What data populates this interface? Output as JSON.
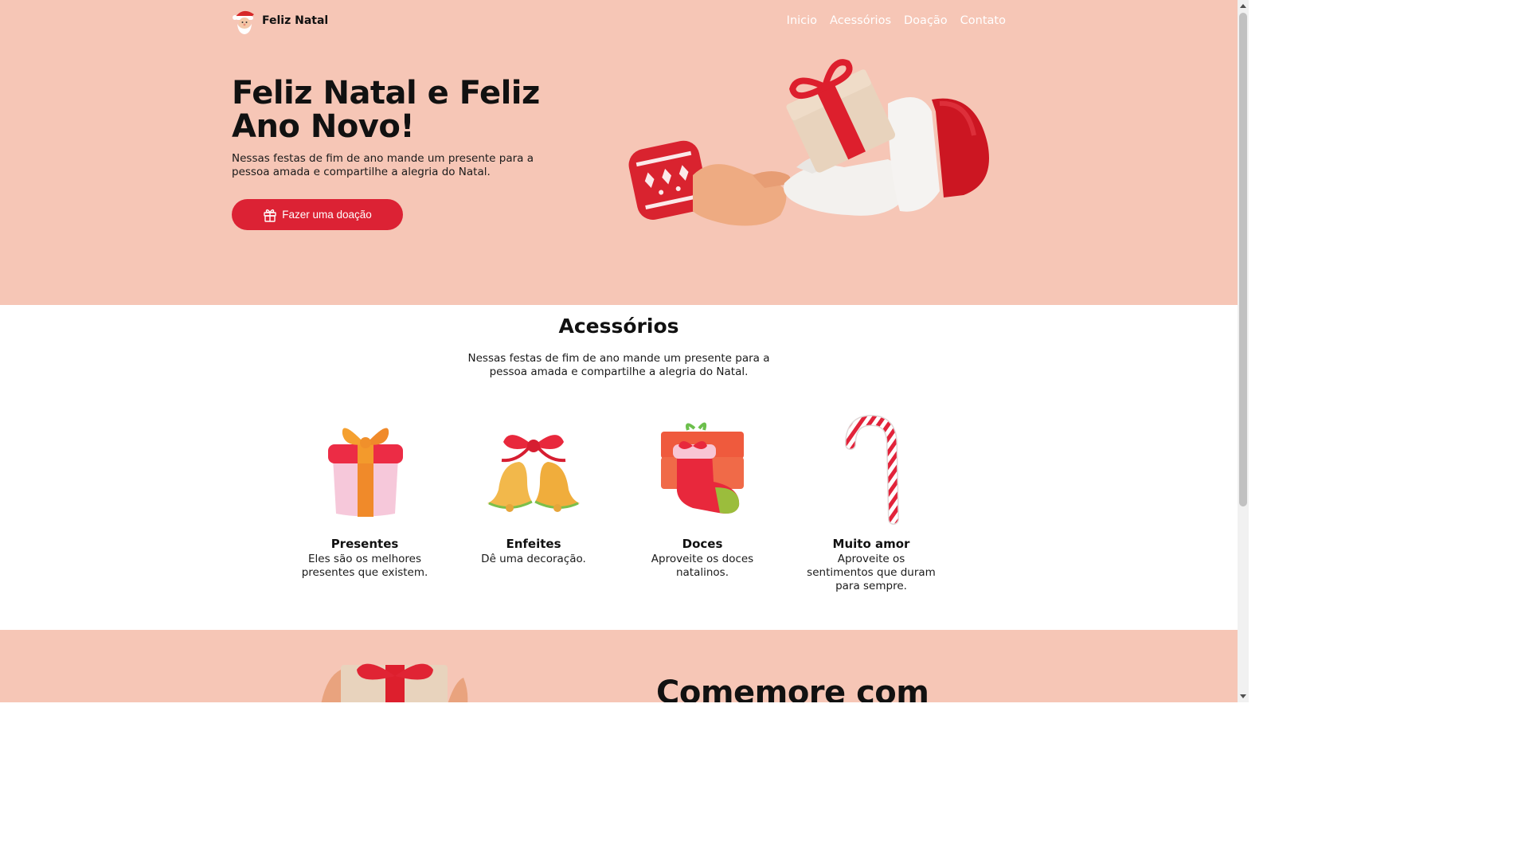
{
  "nav": {
    "brand": "Feliz Natal",
    "links": [
      "Inicio",
      "Acessórios",
      "Doação",
      "Contato"
    ]
  },
  "hero": {
    "title": "Feliz Natal e Feliz Ano Novo!",
    "text": "Nessas festas de fim de ano mande um presente para a pessoa amada e compartilhe a alegria do Natal.",
    "cta": "Fazer uma doação"
  },
  "accessories": {
    "title": "Acessórios",
    "text": "Nessas festas de fim de ano mande um presente para a pessoa amada e compartilhe a alegria do Natal.",
    "items": [
      {
        "name": "Presentes",
        "desc": "Eles são os melhores presentes que existem.",
        "icon": "gift-box-icon"
      },
      {
        "name": "Enfeites",
        "desc": "Dê uma decoração.",
        "icon": "bells-icon"
      },
      {
        "name": "Doces",
        "desc": "Aproveite os doces natalinos.",
        "icon": "stocking-icon"
      },
      {
        "name": "Muito amor",
        "desc": "Aproveite os sentimentos que duram para sempre.",
        "icon": "candy-cane-icon"
      }
    ]
  },
  "section2": {
    "title": "Comemore com"
  },
  "colors": {
    "hero_bg": "#f6c6b6",
    "accent": "#dc2234",
    "nav_text": "#ffffff"
  }
}
